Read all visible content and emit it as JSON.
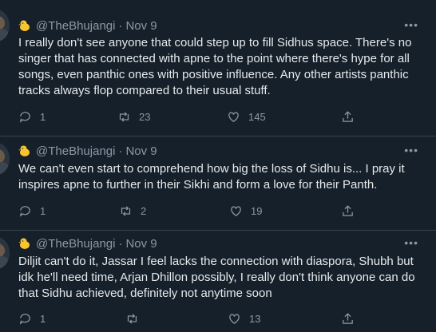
{
  "tweets": [
    {
      "handle": "@TheBhujangi",
      "separator": "·",
      "date": "Nov 9",
      "more_icon": "more-icon",
      "text": "I really don't see anyone that could step up to fill Sidhus space. There's no singer that has connected with apne to the point where there's hype for all songs, even panthic ones with positive influence. Any other artists panthic tracks always flop compared to their usual stuff.",
      "replies": "1",
      "retweets": "23",
      "likes": "145"
    },
    {
      "handle": "@TheBhujangi",
      "separator": "·",
      "date": "Nov 9",
      "more_icon": "more-icon",
      "text": "We can't even start to comprehend how big the loss of Sidhu is... I pray it inspires apne to further in their Sikhi and form a love for their Panth.",
      "replies": "1",
      "retweets": "2",
      "likes": "19"
    },
    {
      "handle": "@TheBhujangi",
      "separator": "·",
      "date": "Nov 9",
      "more_icon": "more-icon",
      "text": "Diljit can't do it, Jassar I feel lacks the connection with diaspora, Shubh but idk he'll need time, Arjan Dhillon possibly, I really don't think anyone can do that Sidhu achieved, definitely not anytime soon",
      "replies": "1",
      "retweets": "",
      "likes": "13"
    }
  ],
  "colors": {
    "background": "#15202b",
    "text": "#e7e9ea",
    "muted": "#8b98a5",
    "divider": "#38444d"
  }
}
